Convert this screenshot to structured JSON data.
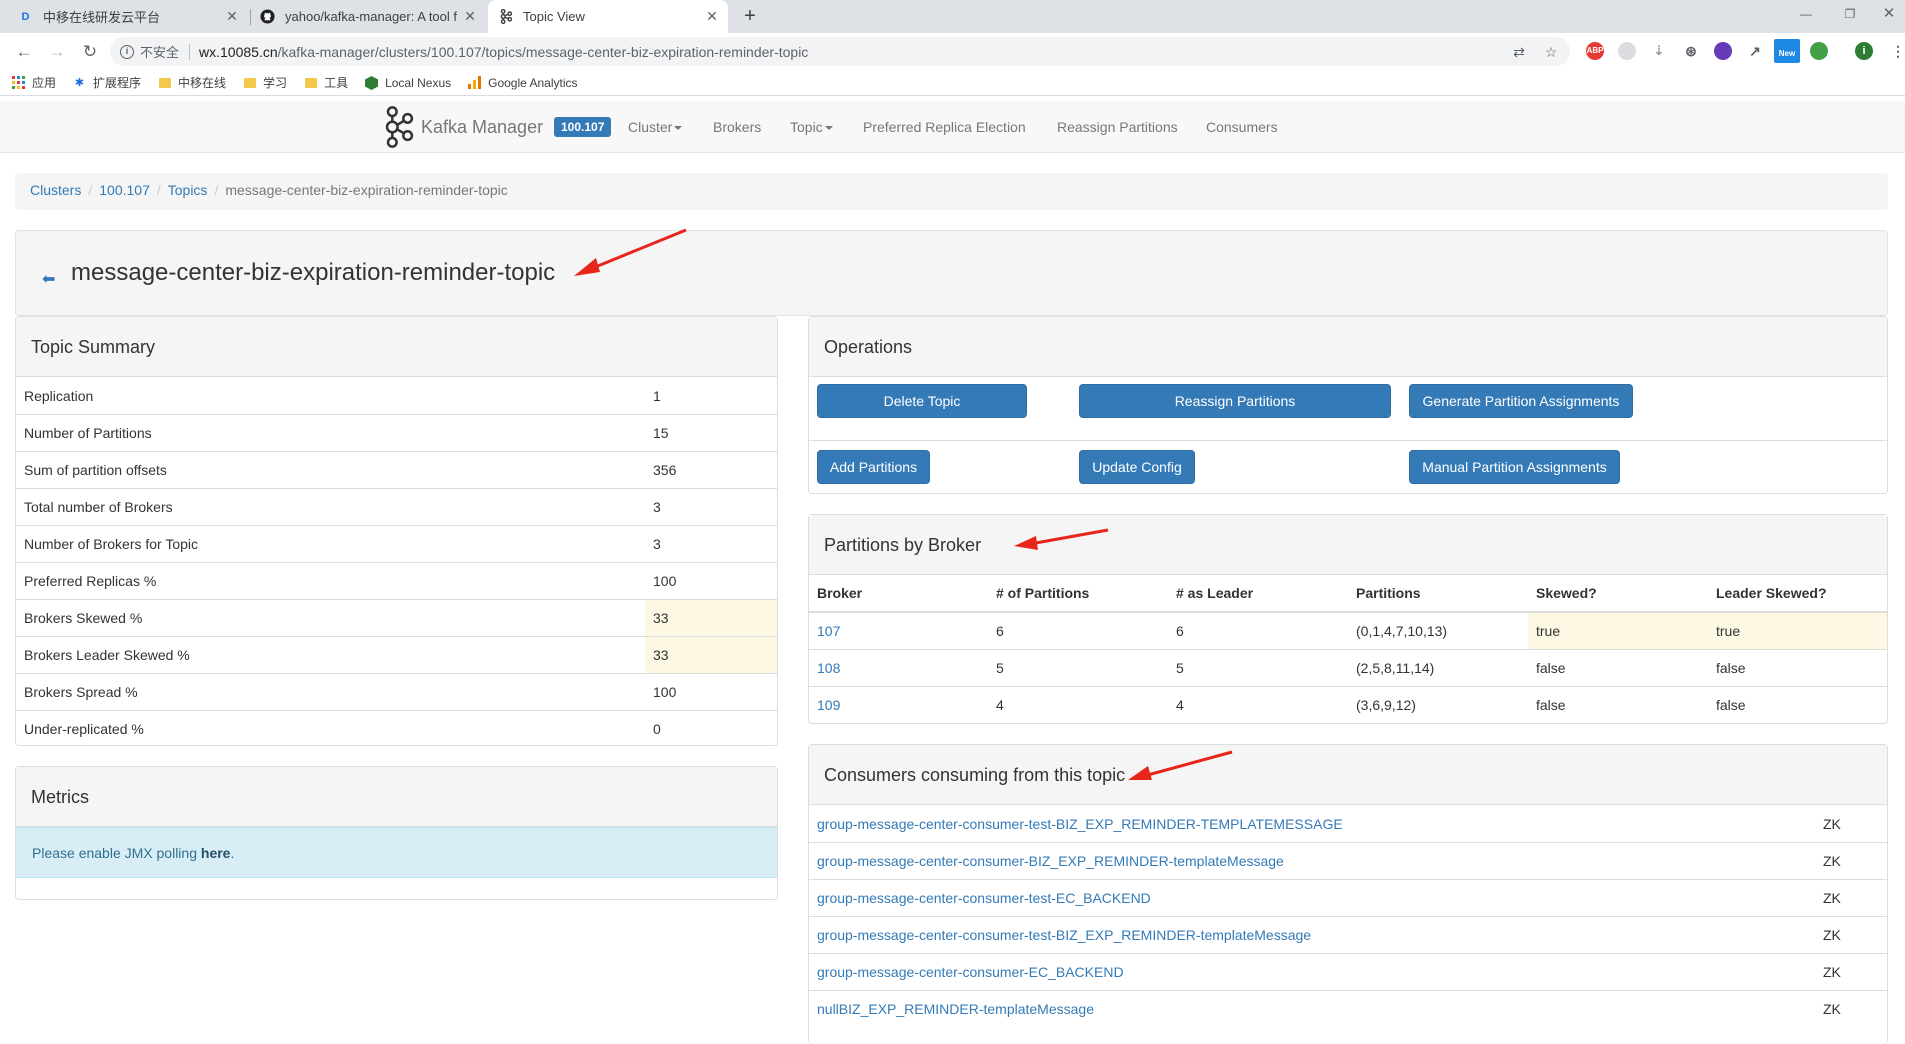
{
  "browser": {
    "tabs": [
      {
        "title": "中移在线研发云平台",
        "icon": "D"
      },
      {
        "title": "yahoo/kafka-manager: A tool f",
        "icon": "github"
      },
      {
        "title": "Topic View",
        "icon": "kafka"
      }
    ],
    "new_tab": "+",
    "address": {
      "security_label": "不安全",
      "host": "wx.10085.cn",
      "path": "/kafka-manager/clusters/100.107/topics/message-center-biz-expiration-reminder-topic"
    },
    "bookmarks": [
      {
        "label": "应用",
        "icon": "apps-grid-icon"
      },
      {
        "label": "扩展程序",
        "icon": "puzzle-icon"
      },
      {
        "label": "中移在线",
        "icon": "folder-icon"
      },
      {
        "label": "学习",
        "icon": "folder-icon"
      },
      {
        "label": "工具",
        "icon": "folder-icon"
      },
      {
        "label": "Local Nexus",
        "icon": "hexagon-icon"
      },
      {
        "label": "Google Analytics",
        "icon": "analytics-icon"
      }
    ]
  },
  "km": {
    "brand": "Kafka Manager",
    "cluster_badge": "100.107",
    "nav": {
      "cluster": "Cluster",
      "brokers": "Brokers",
      "topic": "Topic",
      "preferred": "Preferred Replica Election",
      "reassign": "Reassign Partitions",
      "consumers": "Consumers"
    },
    "breadcrumb": [
      "Clusters",
      "100.107",
      "Topics",
      "message-center-biz-expiration-reminder-topic"
    ],
    "title": "message-center-biz-expiration-reminder-topic",
    "summary": {
      "heading": "Topic Summary",
      "rows": [
        {
          "k": "Replication",
          "v": "1"
        },
        {
          "k": "Number of Partitions",
          "v": "15"
        },
        {
          "k": "Sum of partition offsets",
          "v": "356"
        },
        {
          "k": "Total number of Brokers",
          "v": "3"
        },
        {
          "k": "Number of Brokers for Topic",
          "v": "3"
        },
        {
          "k": "Preferred Replicas %",
          "v": "100"
        },
        {
          "k": "Brokers Skewed %",
          "v": "33"
        },
        {
          "k": "Brokers Leader Skewed %",
          "v": "33"
        },
        {
          "k": "Brokers Spread %",
          "v": "100"
        },
        {
          "k": "Under-replicated %",
          "v": "0"
        }
      ]
    },
    "metrics": {
      "heading": "Metrics",
      "alert_prefix": "Please enable JMX polling ",
      "alert_link": "here",
      "alert_suffix": "."
    },
    "operations": {
      "heading": "Operations",
      "delete": "Delete Topic",
      "reassign": "Reassign Partitions",
      "generate": "Generate Partition Assignments",
      "add": "Add Partitions",
      "update": "Update Config",
      "manual": "Manual Partition Assignments"
    },
    "partitions_by_broker": {
      "heading": "Partitions by Broker",
      "columns": [
        "Broker",
        "# of Partitions",
        "# as Leader",
        "Partitions",
        "Skewed?",
        "Leader Skewed?"
      ],
      "rows": [
        {
          "broker": "107",
          "count": "6",
          "leader": "6",
          "partitions": "(0,1,4,7,10,13)",
          "skewed": "true",
          "leader_skewed": "true"
        },
        {
          "broker": "108",
          "count": "5",
          "leader": "5",
          "partitions": "(2,5,8,11,14)",
          "skewed": "false",
          "leader_skewed": "false"
        },
        {
          "broker": "109",
          "count": "4",
          "leader": "4",
          "partitions": "(3,6,9,12)",
          "skewed": "false",
          "leader_skewed": "false"
        }
      ]
    },
    "consumers": {
      "heading": "Consumers consuming from this topic",
      "rows": [
        {
          "name": "group-message-center-consumer-test-BIZ_EXP_REMINDER-TEMPLATEMESSAGE",
          "type": "ZK"
        },
        {
          "name": "group-message-center-consumer-BIZ_EXP_REMINDER-templateMessage",
          "type": "ZK"
        },
        {
          "name": "group-message-center-consumer-test-EC_BACKEND",
          "type": "ZK"
        },
        {
          "name": "group-message-center-consumer-test-BIZ_EXP_REMINDER-templateMessage",
          "type": "ZK"
        },
        {
          "name": "group-message-center-consumer-EC_BACKEND",
          "type": "ZK"
        },
        {
          "name": "nullBIZ_EXP_REMINDER-templateMessage",
          "type": "ZK"
        }
      ]
    }
  },
  "colors": {
    "primary": "#337ab7",
    "warning_bg": "#fcf8e3",
    "info_bg": "#d9edf7",
    "annotation_arrow": "#e8251b"
  }
}
